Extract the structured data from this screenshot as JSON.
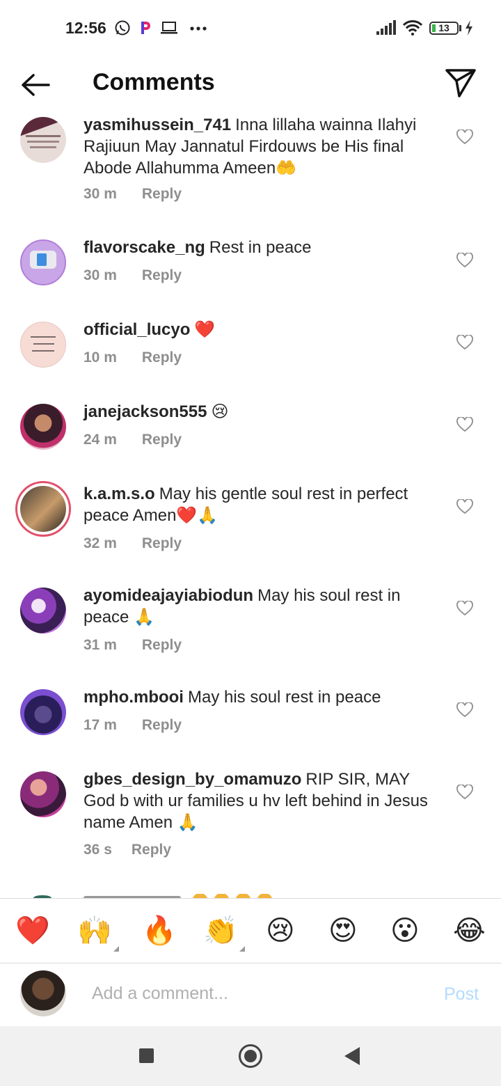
{
  "status_bar": {
    "time": "12:56",
    "battery": "13",
    "icons": [
      "whatsapp-icon",
      "p-app-icon",
      "laptop-icon",
      "more-icon",
      "signal-icon",
      "wifi-icon",
      "battery-icon",
      "charging-icon"
    ]
  },
  "header": {
    "title": "Comments"
  },
  "comments": [
    {
      "username": "yasmihussein_741",
      "text": "Inna lillaha wainna Ilahyi Rajiuun May Jannatul Firdouws be His final Abode Allahumma Ameen🤲",
      "time": "30 m",
      "reply": "Reply"
    },
    {
      "username": "flavorscake_ng",
      "text": "Rest in peace",
      "time": "30 m",
      "reply": "Reply"
    },
    {
      "username": "official_lucyo",
      "text": "❤️",
      "time": "10 m",
      "reply": "Reply"
    },
    {
      "username": "janejackson555",
      "text": "😢",
      "time": "24 m",
      "reply": "Reply"
    },
    {
      "username": "k.a.m.s.o",
      "text": "May his gentle soul rest in perfect peace Amen❤️🙏",
      "time": "32 m",
      "reply": "Reply"
    },
    {
      "username": "ayomideajayiabiodun",
      "text": "May his soul rest in peace 🙏",
      "time": "31 m",
      "reply": "Reply"
    },
    {
      "username": "mpho.mbooi",
      "text": "May his soul rest in peace",
      "time": "17 m",
      "reply": "Reply"
    },
    {
      "username": "gbes_design_by_omamuzo",
      "text": "RIP SIR, MAY God b with ur families u hv left behind in Jesus name Amen 🙏",
      "time": "36 s",
      "reply": "Reply"
    }
  ],
  "emoji_bar": [
    "❤️",
    "🙌",
    "🔥",
    "👏",
    "😢",
    "😍",
    "😮",
    "😂"
  ],
  "composer": {
    "placeholder": "Add a comment...",
    "post_label": "Post"
  },
  "colors": {
    "post_disabled": "#b3dbff",
    "story_ring": "#e2506a",
    "heart_red": "#e0245e"
  }
}
